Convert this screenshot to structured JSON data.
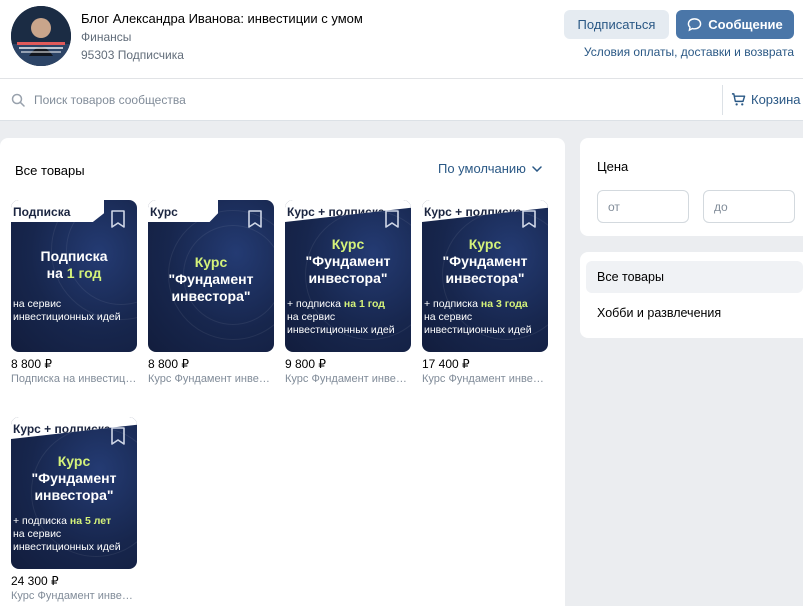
{
  "header": {
    "title": "Блог Александра Иванова: инвестиции с умом",
    "category": "Финансы",
    "subscribers": "95303 Подписчика",
    "subscribe_label": "Подписаться",
    "message_label": "Сообщение",
    "conditions_link": "Условия оплаты, доставки и возврата"
  },
  "search": {
    "placeholder": "Поиск товаров сообщества",
    "cart_label": "Корзина"
  },
  "catalog": {
    "heading": "Все товары",
    "sort_label": "По умолчанию",
    "products": [
      {
        "tag": "Подписка",
        "main_lines": [
          "Подписка",
          "на ",
          "1 год"
        ],
        "sub_lines": [
          "на сервис",
          "инвестиционных идей"
        ],
        "price": "8 800 ₽",
        "name": "Подписка на инвестиционные идеи"
      },
      {
        "tag": "Курс",
        "main_lines": [
          "Курс",
          "\"Фундамент",
          "инвестора\""
        ],
        "sub_lines": [],
        "price": "8 800 ₽",
        "name": "Курс Фундамент инвестора"
      },
      {
        "tag": "Курс + подписка",
        "main_lines": [
          "Курс",
          "\"Фундамент",
          "инвестора\""
        ],
        "sub_prefix": "+ подписка ",
        "sub_highlight": "на 1 год",
        "sub_lines": [
          "на сервис",
          "инвестиционных идей"
        ],
        "price": "9 800 ₽",
        "name": "Курс Фундамент инвестора + подписка"
      },
      {
        "tag": "Курс + подписка",
        "main_lines": [
          "Курс",
          "\"Фундамент",
          "инвестора\""
        ],
        "sub_prefix": "+ подписка ",
        "sub_highlight": "на 3 года",
        "sub_lines": [
          "на сервис",
          "инвестиционных идей"
        ],
        "price": "17 400 ₽",
        "name": "Курс Фундамент инвестора + подписка"
      },
      {
        "tag": "Курс + подписка",
        "main_lines": [
          "Курс",
          "\"Фундамент",
          "инвестора\""
        ],
        "sub_prefix": "+ подписка ",
        "sub_highlight": "на 5 лет",
        "sub_lines": [
          "на сервис",
          "инвестиционных идей"
        ],
        "price": "24 300 ₽",
        "name": "Курс Фундамент инвестора + подписка"
      }
    ]
  },
  "filters": {
    "price_label": "Цена",
    "from_placeholder": "от",
    "to_placeholder": "до",
    "categories": [
      "Все товары",
      "Хобби и развлечения"
    ]
  },
  "colors": {
    "accent": "#4a76a8",
    "link": "#2a5885",
    "card_bg": "#17264d",
    "highlight": "#d4f27a"
  }
}
